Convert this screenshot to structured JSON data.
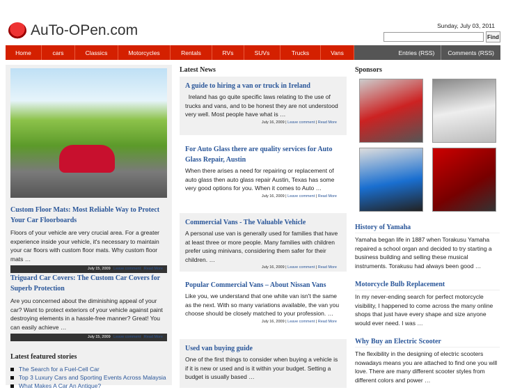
{
  "site": {
    "title": "AuTo-OPen.com",
    "date": "Sunday, July 03, 2011",
    "find_label": "Find",
    "search_value": ""
  },
  "nav": {
    "items": [
      "Home",
      "cars",
      "Classics",
      "Motorcycles",
      "Rentals",
      "RVs",
      "SUVs",
      "Trucks",
      "Vans"
    ],
    "rss": [
      "Entries (RSS)",
      "Comments (RSS)"
    ]
  },
  "left": {
    "posts": [
      {
        "title": "Custom Floor Mats: Most Reliable Way to Protect Your Car Floorboards",
        "text": "Floors of your vehicle are very crucial area. For a greater experience inside your vehicle, it's necessary to maintain your car floors with custom floor mats. Why custom floor mats …",
        "date": "July 15, 2009",
        "comment": "Leave comment",
        "more": "Read More"
      },
      {
        "title": "Triguard Car Covers: The Custom Car Covers for Superb Protection",
        "text": "Are you concerned about the diminishing appeal of your car? Want to protect exteriors of your vehicle against paint destroying elements in a hassle-free manner? Great! You can easily achieve …",
        "date": "July 15, 2009",
        "comment": "Leave comment",
        "more": "Read More"
      }
    ],
    "featured_heading": "Latest featured stories",
    "featured": [
      "The Search for a Fuel-Cell Car",
      "Top 3 Luxury Cars and Sporting Events Across Malaysia",
      "What Makes A Car An Antique?"
    ]
  },
  "center": {
    "heading": "Latest News",
    "posts": [
      {
        "title": "A guide to hiring a van or truck in Ireland",
        "text": "  Ireland has go quite specific laws relating to the use of trucks and vans, and to be honest they are not understood very well. Most people have what is …",
        "date": "July 16, 2009",
        "comment": "Leave comment",
        "more": "Read More"
      },
      {
        "title": "For Auto Glass there are quality services for Auto Glass Repair, Austin",
        "text": "When there arises a need for repairing or replacement of auto glass then auto glass repair Austin, Texas has some very good options for you. When it comes to Auto …",
        "date": "July 16, 2009",
        "comment": "Leave comment",
        "more": "Read More"
      },
      {
        "title": "Commercial Vans - The Valuable Vehicle",
        "text": "A personal use van is generally used for families that have at least three or more people. Many families with children prefer using minivans, considering them safer for their children. …",
        "date": "July 16, 2009",
        "comment": "Leave comment",
        "more": "Read More"
      },
      {
        "title": "Popular Commercial Vans – About Nissan Vans",
        "text": "Like you, we understand that one white van isn't the same as the next. With so many variations available, the van you choose should be closely matched to your profession. …",
        "date": "July 16, 2009",
        "comment": "Leave comment",
        "more": "Read More"
      },
      {
        "title": "Used van buying guide",
        "text": "One of the first things to consider when buying a vehicle is if it is new or used and is it within your budget. Setting a budget is usually based …",
        "date": "",
        "comment": "",
        "more": ""
      }
    ]
  },
  "right": {
    "heading": "Sponsors",
    "posts": [
      {
        "title": "History of Yamaha",
        "text": "Yamaha began life in 1887 when Torakusu Yamaha repaired a school organ and decided to try starting a business building and selling these musical instruments. Torakusu had always been good …"
      },
      {
        "title": "Motorcycle Bulb Replacement",
        "text": "In my never-ending search for perfect motorcycle visibility, I happened to come across the many online shops that just have every shape and size anyone would ever need.  I was …"
      },
      {
        "title": "Why Buy an Electric Scooter",
        "text": "The flexibility in the designing of electric scooters nowadays means you are attached to find one you will love. There are many different scooter styles from different colors and power …"
      }
    ]
  }
}
